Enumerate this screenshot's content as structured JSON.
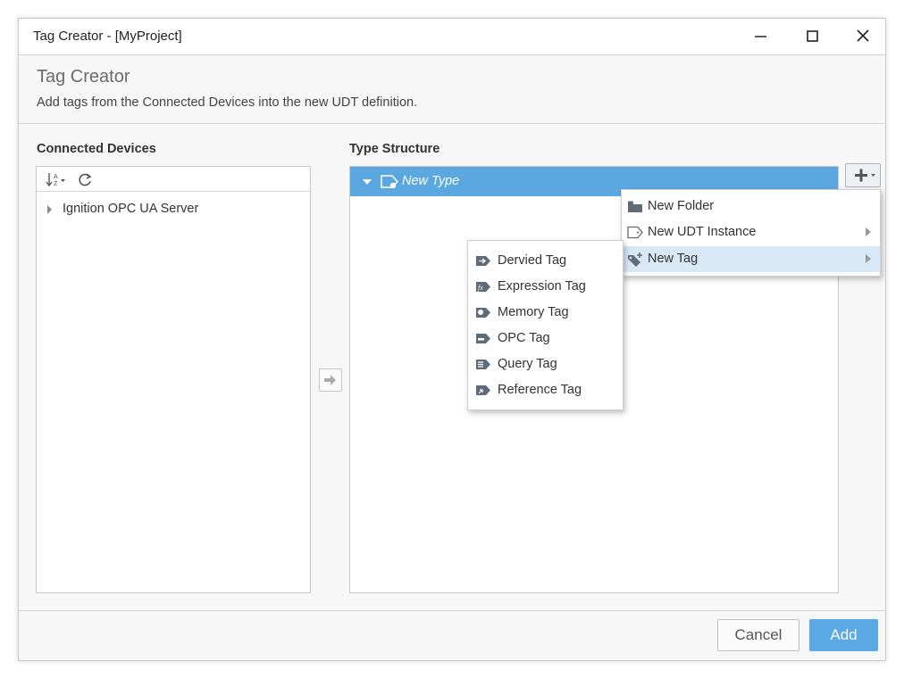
{
  "window": {
    "title": "Tag Creator - [MyProject]"
  },
  "header": {
    "title": "Tag Creator",
    "description": "Add tags from the Connected Devices into the new UDT definition."
  },
  "connected_devices": {
    "label": "Connected Devices",
    "toolbar_icons": [
      "sort-icon",
      "refresh-icon"
    ],
    "items": [
      {
        "label": "Ignition OPC UA Server"
      }
    ]
  },
  "type_structure": {
    "label": "Type Structure",
    "root": {
      "label": "New Type"
    }
  },
  "add_menu": {
    "items": [
      {
        "label": "New Folder",
        "icon": "folder-icon"
      },
      {
        "label": "New UDT Instance",
        "icon": "udt-instance-icon"
      },
      {
        "label": "New Tag",
        "icon": "tag-add-icon"
      }
    ]
  },
  "new_tag_submenu": {
    "items": [
      {
        "label": "Dervied Tag",
        "icon": "derived-tag-icon"
      },
      {
        "label": "Expression Tag",
        "icon": "expression-tag-icon"
      },
      {
        "label": "Memory Tag",
        "icon": "memory-tag-icon"
      },
      {
        "label": "OPC Tag",
        "icon": "opc-tag-icon"
      },
      {
        "label": "Query Tag",
        "icon": "query-tag-icon"
      },
      {
        "label": "Reference Tag",
        "icon": "reference-tag-icon"
      }
    ]
  },
  "footer": {
    "cancel_label": "Cancel",
    "add_label": "Add"
  },
  "colors": {
    "accent": "#5aa8e4",
    "selection": "#5ba7e0",
    "menu_highlight": "#d8e8f6",
    "icon": "#5f6b78"
  }
}
